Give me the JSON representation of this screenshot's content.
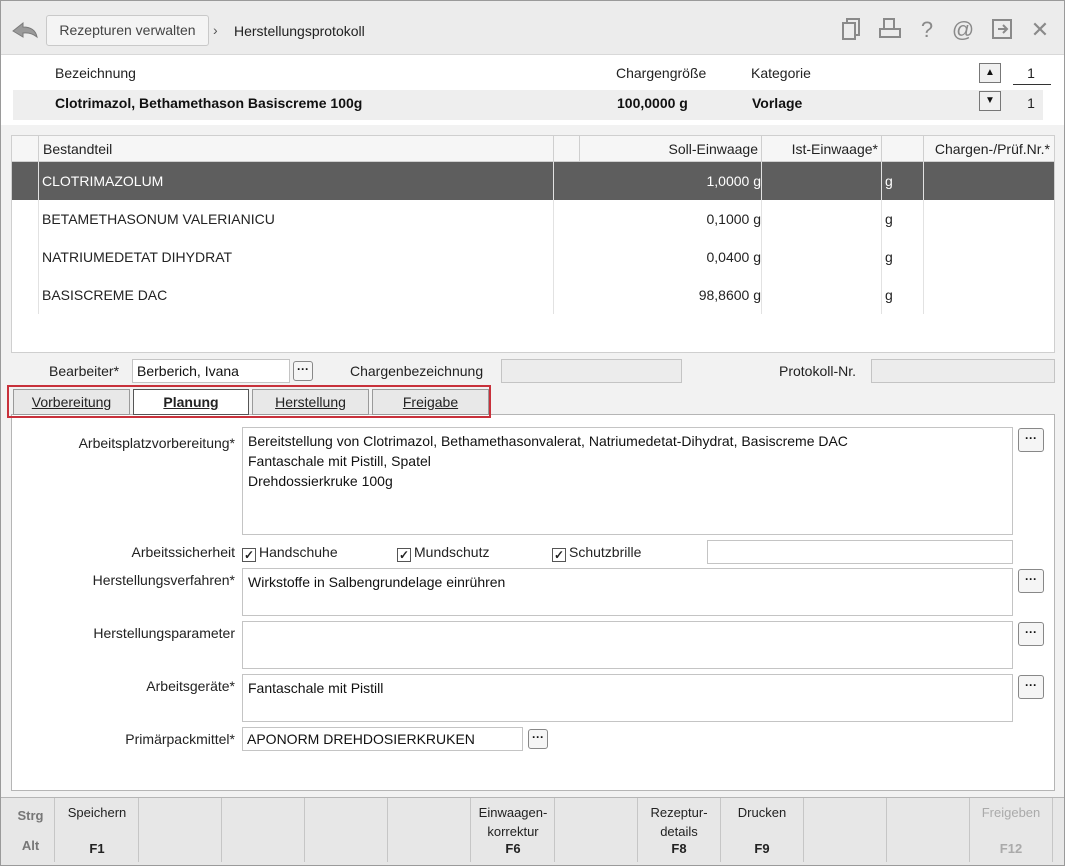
{
  "titlebar": {
    "breadcrumb_button": "Rezepturen verwalten",
    "separator": "›",
    "title": "Herstellungsprotokoll",
    "icons": [
      "copy-icon",
      "print-icon",
      "help-icon",
      "at-icon",
      "exit-icon",
      "close-icon"
    ]
  },
  "header": {
    "col_name": "Bezeichnung",
    "col_batch_size": "Chargengröße",
    "col_category": "Kategorie",
    "name": "Clotrimazol, Bethamethason Basiscreme 100g",
    "batch_size": "100,0000 g",
    "category": "Vorlage",
    "pager_top": "1",
    "pager_bottom": "1"
  },
  "table": {
    "headers": [
      "Bestandteil",
      "",
      "Soll-Einwaage",
      "Ist-Einwaage*",
      "",
      "Chargen-/Prüf.Nr.*"
    ],
    "rows": [
      {
        "name": "CLOTRIMAZOLUM",
        "soll": "1,0000 g",
        "unit": "g",
        "selected": true
      },
      {
        "name": "BETAMETHASONUM VALERIANICU",
        "soll": "0,1000 g",
        "unit": "g",
        "selected": false
      },
      {
        "name": "NATRIUMEDETAT DIHYDRAT",
        "soll": "0,0400 g",
        "unit": "g",
        "selected": false
      },
      {
        "name": "BASISCREME DAC",
        "soll": "98,8600 g",
        "unit": "g",
        "selected": false
      }
    ]
  },
  "meta": {
    "bearbeiter_label": "Bearbeiter*",
    "bearbeiter_value": "Berberich, Ivana",
    "chargenbez_label": "Chargenbezeichnung",
    "chargenbez_value": "",
    "protokoll_label": "Protokoll-Nr.",
    "protokoll_value": ""
  },
  "tabs": [
    {
      "label": "Vorbereitung",
      "active": false
    },
    {
      "label": "Planung",
      "active": true
    },
    {
      "label": "Herstellung",
      "active": false
    },
    {
      "label": "Freigabe",
      "active": false
    }
  ],
  "planung": {
    "arbeitsplatz_label": "Arbeitsplatzvorbereitung*",
    "arbeitsplatz_value": "Bereitstellung von Clotrimazol, Bethamethasonvalerat, Natriumedetat-Dihydrat, Basiscreme DAC\nFantaschale mit Pistill, Spatel\nDrehdossierkruke 100g",
    "sicherheit_label": "Arbeitssicherheit",
    "checks": [
      {
        "label": "Handschuhe",
        "checked": true
      },
      {
        "label": "Mundschutz",
        "checked": true
      },
      {
        "label": "Schutzbrille",
        "checked": true
      }
    ],
    "sicherheit_extra": "",
    "verfahren_label": "Herstellungsverfahren*",
    "verfahren_value": "Wirkstoffe in Salbengrundelage einrühren",
    "parameter_label": "Herstellungsparameter",
    "parameter_value": "",
    "geraete_label": "Arbeitsgeräte*",
    "geraete_value": "Fantaschale mit Pistill",
    "packmittel_label": "Primärpackmittel*",
    "packmittel_value": "APONORM DREHDOSIERKRUKEN",
    "dots": "···"
  },
  "fkeys": {
    "mod_strg": "Strg",
    "mod_alt": "Alt",
    "keys": [
      {
        "label": "Speichern",
        "code": "F1",
        "enabled": true
      },
      {
        "label": "",
        "code": "",
        "enabled": true
      },
      {
        "label": "",
        "code": "",
        "enabled": true
      },
      {
        "label": "",
        "code": "",
        "enabled": true
      },
      {
        "label": "",
        "code": "",
        "enabled": true
      },
      {
        "label": "Einwaagen-\nkorrektur",
        "code": "F6",
        "enabled": true
      },
      {
        "label": "",
        "code": "",
        "enabled": true
      },
      {
        "label": "Rezeptur-\ndetails",
        "code": "F8",
        "enabled": true
      },
      {
        "label": "Drucken",
        "code": "F9",
        "enabled": true
      },
      {
        "label": "",
        "code": "",
        "enabled": true
      },
      {
        "label": "",
        "code": "",
        "enabled": true
      },
      {
        "label": "Freigeben",
        "code": "F12",
        "enabled": false
      }
    ]
  }
}
